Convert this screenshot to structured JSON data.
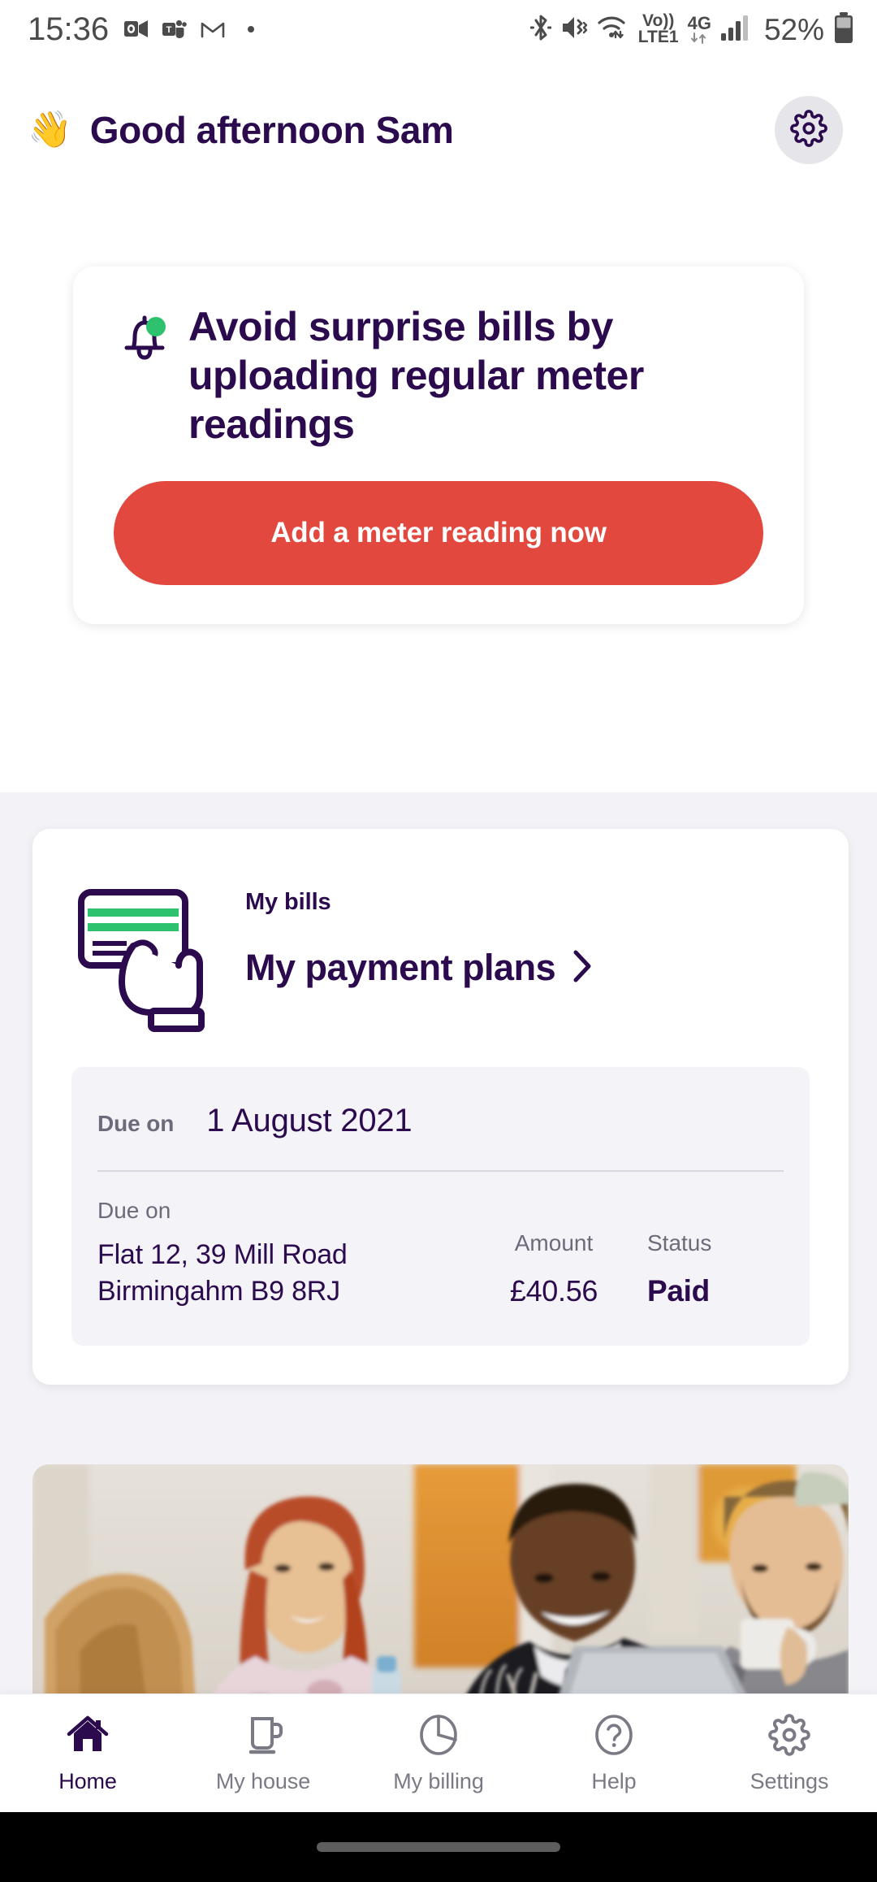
{
  "status_bar": {
    "time": "15:36",
    "left_icons": [
      "outlook-icon",
      "teams-icon",
      "gmail-icon",
      "dot-icon"
    ],
    "right_icons": [
      "bluetooth-icon",
      "vibrate-icon",
      "wifi-icon",
      "signal-icon"
    ],
    "volte_line1": "Vo))",
    "volte_line2": "LTE1",
    "network_type": "4G",
    "battery_percent": "52%"
  },
  "header": {
    "wave_emoji": "👋",
    "greeting": "Good afternoon Sam",
    "settings_icon": "gear-icon"
  },
  "promo": {
    "bell_icon": "bell-icon",
    "title": "Avoid surprise bills by uploading regular meter readings",
    "cta_label": "Add a meter reading now",
    "cta_color": "#e2483e"
  },
  "bills": {
    "illustration": "hand-pointing-card-icon",
    "section_label": "My bills",
    "link_label": "My payment plans",
    "chevron": "›",
    "due_on_label": "Due on",
    "due_on_value": "1 August 2021",
    "detail": {
      "address_label": "Due on",
      "address_line1": "Flat 12, 39 Mill Road",
      "address_line2": "Birmingahm B9 8RJ",
      "amount_label": "Amount",
      "amount_value": "£40.56",
      "status_label": "Status",
      "status_value": "Paid"
    }
  },
  "promo_photo": {
    "alt": "four-people-around-table-with-laptop"
  },
  "bottom_nav": {
    "items": [
      {
        "label": "Home",
        "icon": "home-icon",
        "active": true
      },
      {
        "label": "My house",
        "icon": "mug-icon",
        "active": false
      },
      {
        "label": "My billing",
        "icon": "pie-chart-icon",
        "active": false
      },
      {
        "label": "Help",
        "icon": "question-circle-icon",
        "active": false
      },
      {
        "label": "Settings",
        "icon": "gear-icon",
        "active": false
      }
    ]
  },
  "colors": {
    "brand_purple": "#2b0a4d",
    "accent_red": "#e2483e",
    "accent_green": "#2fc26e",
    "grey_bg": "#f3f2f7"
  }
}
